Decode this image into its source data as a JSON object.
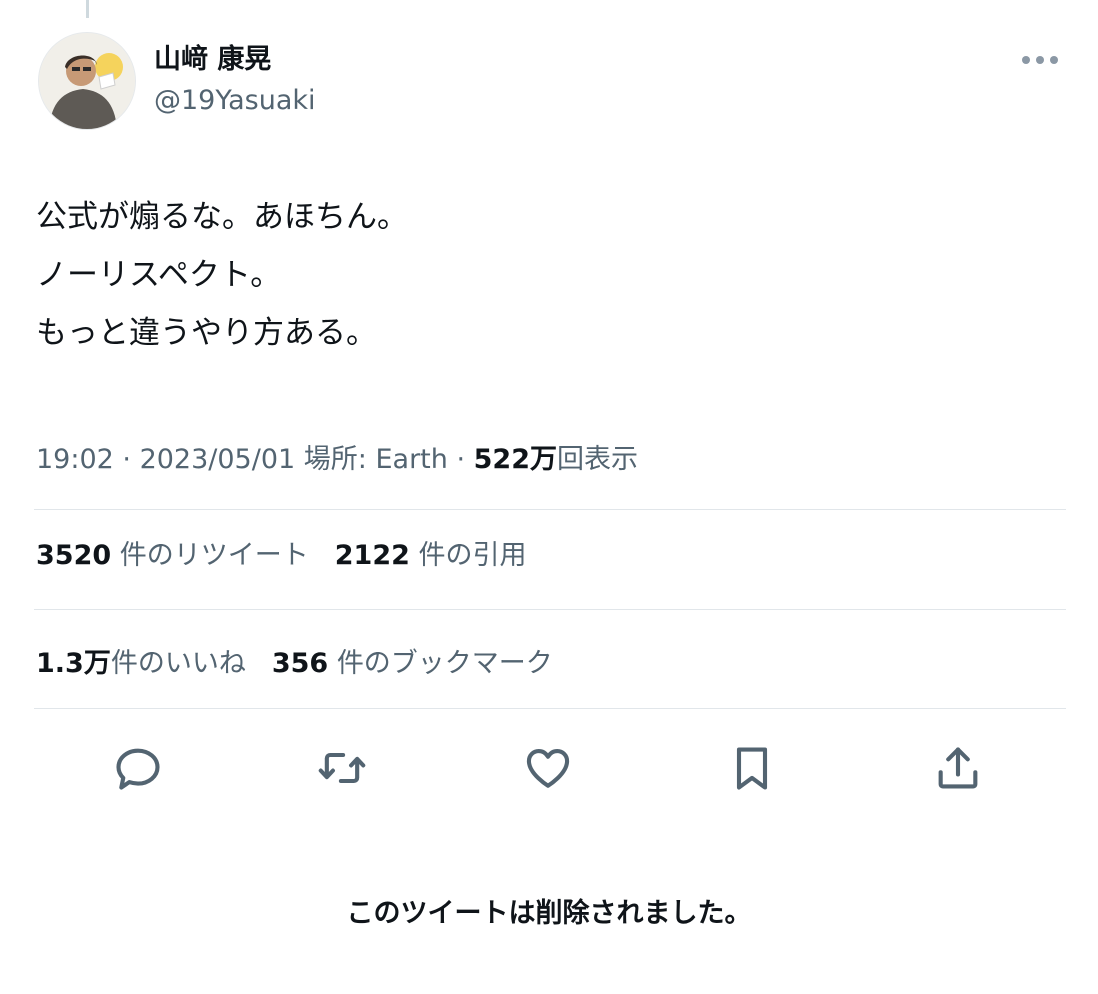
{
  "tweet": {
    "author": {
      "display_name": "山﨑 康晃",
      "handle": "@19Yasuaki",
      "avatar_icon": "user-avatar-icon"
    },
    "text_lines": [
      "公式が煽るな。あほちん。",
      "ノーリスペクト。",
      "もっと違うやり方ある。"
    ],
    "meta": {
      "time": "19:02",
      "separator": " · ",
      "date": "2023/05/01",
      "location": "場所: Earth",
      "views_count": "522万",
      "views_label": "回表示"
    },
    "stats_row1": [
      {
        "count": "3520",
        "label": "件のリツイート"
      },
      {
        "count": "2122",
        "label": "件の引用"
      }
    ],
    "stats_row2": [
      {
        "count": "1.3万",
        "label": "件のいいね"
      },
      {
        "count": "356",
        "label": "件のブックマーク"
      }
    ],
    "actions": [
      "reply-icon",
      "retweet-icon",
      "like-icon",
      "bookmark-icon",
      "share-icon"
    ],
    "deleted_notice": "このツイートは削除されました。"
  },
  "colors": {
    "text": "#0f1419",
    "secondary": "#536471",
    "divider": "#e1e6ea",
    "background": "#ffffff"
  }
}
